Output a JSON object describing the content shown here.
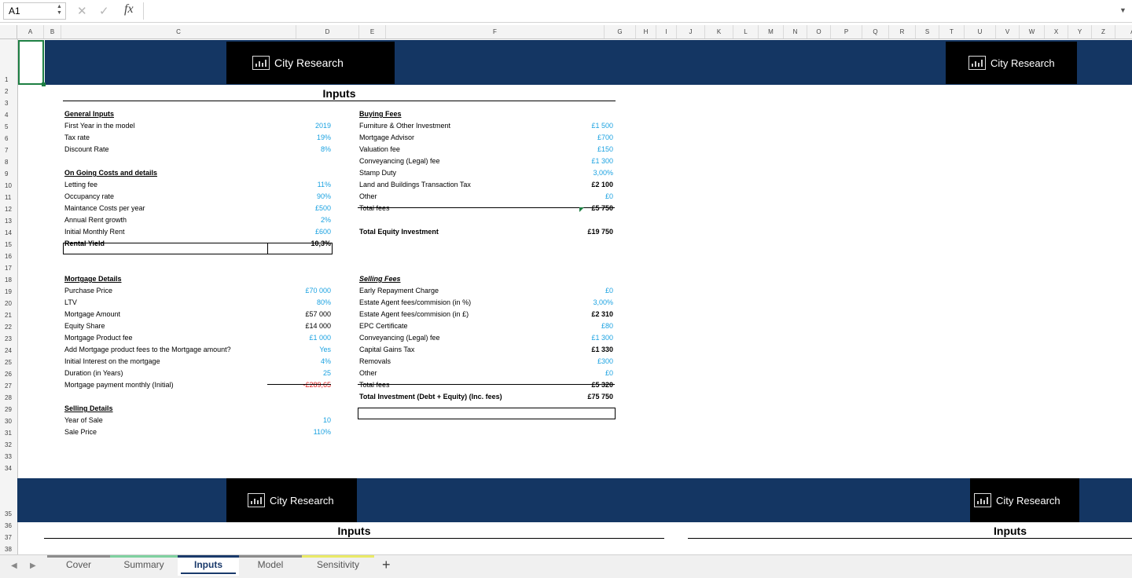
{
  "formula_bar": {
    "cell_ref": "A1",
    "cancel": "✕",
    "confirm": "✓",
    "fx": "fx"
  },
  "columns": [
    "A",
    "B",
    "C",
    "D",
    "E",
    "F",
    "G",
    "H",
    "I",
    "J",
    "K",
    "L",
    "M",
    "N",
    "O",
    "P",
    "Q",
    "R",
    "S",
    "T",
    "U",
    "V",
    "W",
    "X",
    "Y",
    "Z",
    "AA"
  ],
  "rows": [
    "1",
    "2",
    "3",
    "4",
    "5",
    "6",
    "7",
    "8",
    "9",
    "10",
    "11",
    "12",
    "13",
    "14",
    "15",
    "16",
    "17",
    "18",
    "19",
    "20",
    "21",
    "22",
    "23",
    "24",
    "25",
    "26",
    "27",
    "28",
    "29",
    "30",
    "31",
    "32",
    "33",
    "34",
    "35",
    "36",
    "37",
    "38"
  ],
  "brand": {
    "name": "City Research"
  },
  "sheet_title": "Inputs",
  "general": {
    "header": "General Inputs",
    "rows": [
      {
        "label": "First Year in the model",
        "value": "2019"
      },
      {
        "label": "Tax rate",
        "value": "19%"
      },
      {
        "label": "Discount Rate",
        "value": "8%"
      }
    ]
  },
  "ongoing": {
    "header": "On Going Costs and details",
    "rows": [
      {
        "label": "Letting fee",
        "value": "11%"
      },
      {
        "label": "Occupancy rate",
        "value": "90%"
      },
      {
        "label": "Maintance Costs per year",
        "value": "£500"
      },
      {
        "label": "Annual Rent growth",
        "value": "2%"
      },
      {
        "label": "Initial Monthly Rent",
        "value": "£600"
      },
      {
        "label": "Rental Yield",
        "value": "10,3%"
      }
    ]
  },
  "mortgage": {
    "header": "Mortgage Details",
    "rows": [
      {
        "label": "Purchase Price",
        "value": "£70 000"
      },
      {
        "label": "LTV",
        "value": "80%"
      },
      {
        "label": "Mortgage Amount",
        "value": "£57 000"
      },
      {
        "label": "Equity Share",
        "value": "£14 000"
      },
      {
        "label": "Mortgage Product fee",
        "value": "£1 000"
      },
      {
        "label": "Add Mortgage product fees to the Mortgage amount?",
        "value": "Yes"
      },
      {
        "label": "Initial Interest on the mortgage",
        "value": "4%"
      },
      {
        "label": "Duration (in Years)",
        "value": "25"
      },
      {
        "label": "Mortgage payment monthly (Initial)",
        "value": "-£289,65"
      }
    ]
  },
  "selling_details": {
    "header": "Selling Details",
    "rows": [
      {
        "label": "Year of Sale",
        "value": "10"
      },
      {
        "label": "Sale Price",
        "value": "110%"
      }
    ]
  },
  "buying_fees": {
    "header": "Buying Fees",
    "rows": [
      {
        "label": "Furniture & Other Investment",
        "value": "£1 500"
      },
      {
        "label": "Mortgage Advisor",
        "value": "£700"
      },
      {
        "label": "Valuation fee",
        "value": "£150"
      },
      {
        "label": "Conveyancing (Legal) fee",
        "value": "£1 300"
      },
      {
        "label": "Stamp Duty",
        "value": "3,00%"
      },
      {
        "label": "Land and Buildings Transaction Tax",
        "value": "£2 100"
      },
      {
        "label": "Other",
        "value": "£0"
      },
      {
        "label": "Total fees",
        "value": "£5 750"
      }
    ],
    "total_equity_label": "Total Equity Investment",
    "total_equity_value": "£19 750"
  },
  "selling_fees": {
    "header": "Selling Fees",
    "rows": [
      {
        "label": "Early Repayment Charge",
        "value": "£0"
      },
      {
        "label": "Estate Agent fees/commision (in %)",
        "value": "3,00%"
      },
      {
        "label": "Estate Agent fees/commision (in £)",
        "value": "£2 310"
      },
      {
        "label": "EPC Certificate",
        "value": "£80"
      },
      {
        "label": "Conveyancing (Legal) fee",
        "value": "£1 300"
      },
      {
        "label": "Capital Gains Tax",
        "value": "£1 330"
      },
      {
        "label": "Removals",
        "value": "£300"
      },
      {
        "label": "Other",
        "value": "£0"
      },
      {
        "label": "Total fees",
        "value": "£5 320"
      }
    ]
  },
  "total_investment": {
    "label": "Total Investment (Debt + Equity) (Inc. fees)",
    "value": "£75 750"
  },
  "tabs": [
    {
      "label": "Cover",
      "color": "#8c8c8c"
    },
    {
      "label": "Summary",
      "color": "#7fd1a0"
    },
    {
      "label": "Inputs",
      "color": "#1a3a6b"
    },
    {
      "label": "Model",
      "color": "#8c8c8c"
    },
    {
      "label": "Sensitivity",
      "color": "#eaea66"
    }
  ],
  "add_sheet": "+",
  "colors": {
    "banner": "#143663",
    "input_blue": "#1ba2e1",
    "negative_red": "#e01a1a"
  }
}
